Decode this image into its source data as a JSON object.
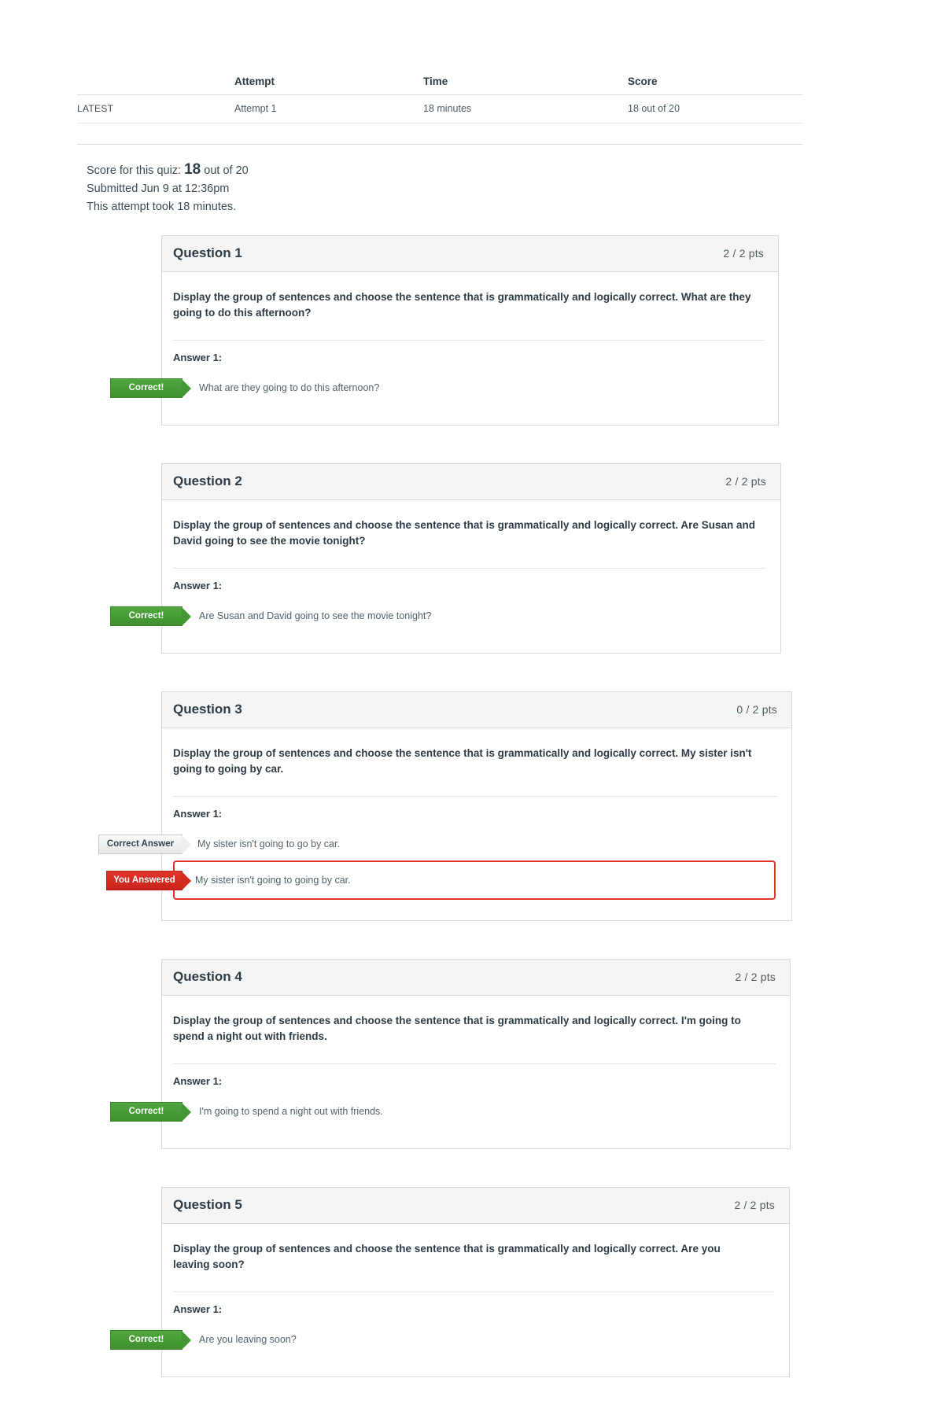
{
  "attempt_table": {
    "headers": [
      "",
      "Attempt",
      "Time",
      "Score"
    ],
    "rows": [
      {
        "label": "LATEST",
        "attempt": "Attempt 1",
        "time": "18 minutes",
        "score": "18 out of 20"
      }
    ]
  },
  "summary": {
    "score_prefix": "Score for this quiz:",
    "score_value": "18",
    "score_suffix": "out of 20",
    "submitted": "Submitted Jun 9 at 12:36pm",
    "duration": "This attempt took 18 minutes."
  },
  "badges": {
    "correct": "Correct!",
    "you_answered": "You Answered",
    "correct_answer": "Correct Answer"
  },
  "labels": {
    "answer_1": "Answer 1:"
  },
  "colors": {
    "correct_green": "#3e8f2e",
    "incorrect_red": "#e0352b",
    "attempt_link_red": "#cc3b3b",
    "header_grey": "#f5f5f5",
    "text_dark": "#2d3b45"
  },
  "questions": [
    {
      "title": "Question 1",
      "points": "2 / 2 pts",
      "text": "Display the group of sentences and choose the sentence that is grammatically and logically correct. What are they going to do this afternoon?",
      "answer_label": "Answer 1:",
      "answers": [
        {
          "badge": "Correct!",
          "badge_type": "correct",
          "text": "What are they going to do this afternoon?",
          "wrong": false
        }
      ]
    },
    {
      "title": "Question 2",
      "points": "2 / 2 pts",
      "text": "Display the group of sentences and choose the sentence that is grammatically and logically correct. Are Susan and David going to see the movie tonight?",
      "answer_label": "Answer 1:",
      "answers": [
        {
          "badge": "Correct!",
          "badge_type": "correct",
          "text": "Are Susan and David going to see the movie tonight?",
          "wrong": false
        }
      ]
    },
    {
      "title": "Question 3",
      "points": "0 / 2 pts",
      "text": "Display the group of sentences and choose the sentence that is grammatically and logically correct. My sister isn't going to going by car.",
      "answer_label": "Answer 1:",
      "answers": [
        {
          "badge": "Correct Answer",
          "badge_type": "correct-answer",
          "text": "My sister isn't going to go by car.",
          "wrong": false
        },
        {
          "badge": "You Answered",
          "badge_type": "you-answered",
          "text": "My sister isn't going to going by car.",
          "wrong": true
        }
      ]
    },
    {
      "title": "Question 4",
      "points": "2 / 2 pts",
      "text": "Display the group of sentences and choose the sentence that is grammatically and logically correct. I'm going to spend a night out with friends.",
      "answer_label": "Answer 1:",
      "answers": [
        {
          "badge": "Correct!",
          "badge_type": "correct",
          "text": "I'm going to spend a night out with friends.",
          "wrong": false
        }
      ]
    },
    {
      "title": "Question 5",
      "points": "2 / 2 pts",
      "text": "Display the group of sentences and choose the sentence that is grammatically and logically correct. Are you leaving soon?",
      "answer_label": "Answer 1:",
      "answers": [
        {
          "badge": "Correct!",
          "badge_type": "correct",
          "text": "Are you leaving soon?",
          "wrong": false
        }
      ]
    }
  ]
}
